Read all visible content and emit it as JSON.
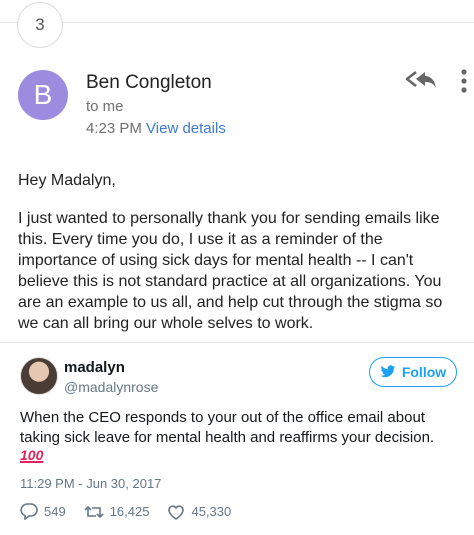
{
  "thread": {
    "count": "3"
  },
  "email": {
    "avatar_letter": "B",
    "sender": "Ben Congleton",
    "recipient": "to me",
    "time": "4:23 PM",
    "view_details": "View details",
    "greeting": "Hey Madalyn,",
    "body": "I just wanted to personally thank you for sending emails like\nthis.  Every time you do, I use it as a reminder of the\nimportance of using sick days for mental health -- I can't\nbelieve this is not standard practice at all organizations.  You\nare an example to us all, and help cut through the stigma so\nwe can all bring our whole selves to work.",
    "icons": [
      "reply-all-icon",
      "more-icon"
    ]
  },
  "tweet": {
    "name": "madalyn",
    "handle": "@madalynrose",
    "follow_label": "Follow",
    "text": "When the CEO responds to your out of the office email about taking sick leave for mental health and reaffirms your decision.",
    "emoji": "💯",
    "time": "11:29 PM - Jun 30, 2017",
    "replies": "549",
    "retweets": "16,425",
    "likes": "45,330",
    "colors": {
      "accent": "#1da1f2",
      "link": "#3b7bd2",
      "avatar": "#9b8ce0"
    }
  }
}
